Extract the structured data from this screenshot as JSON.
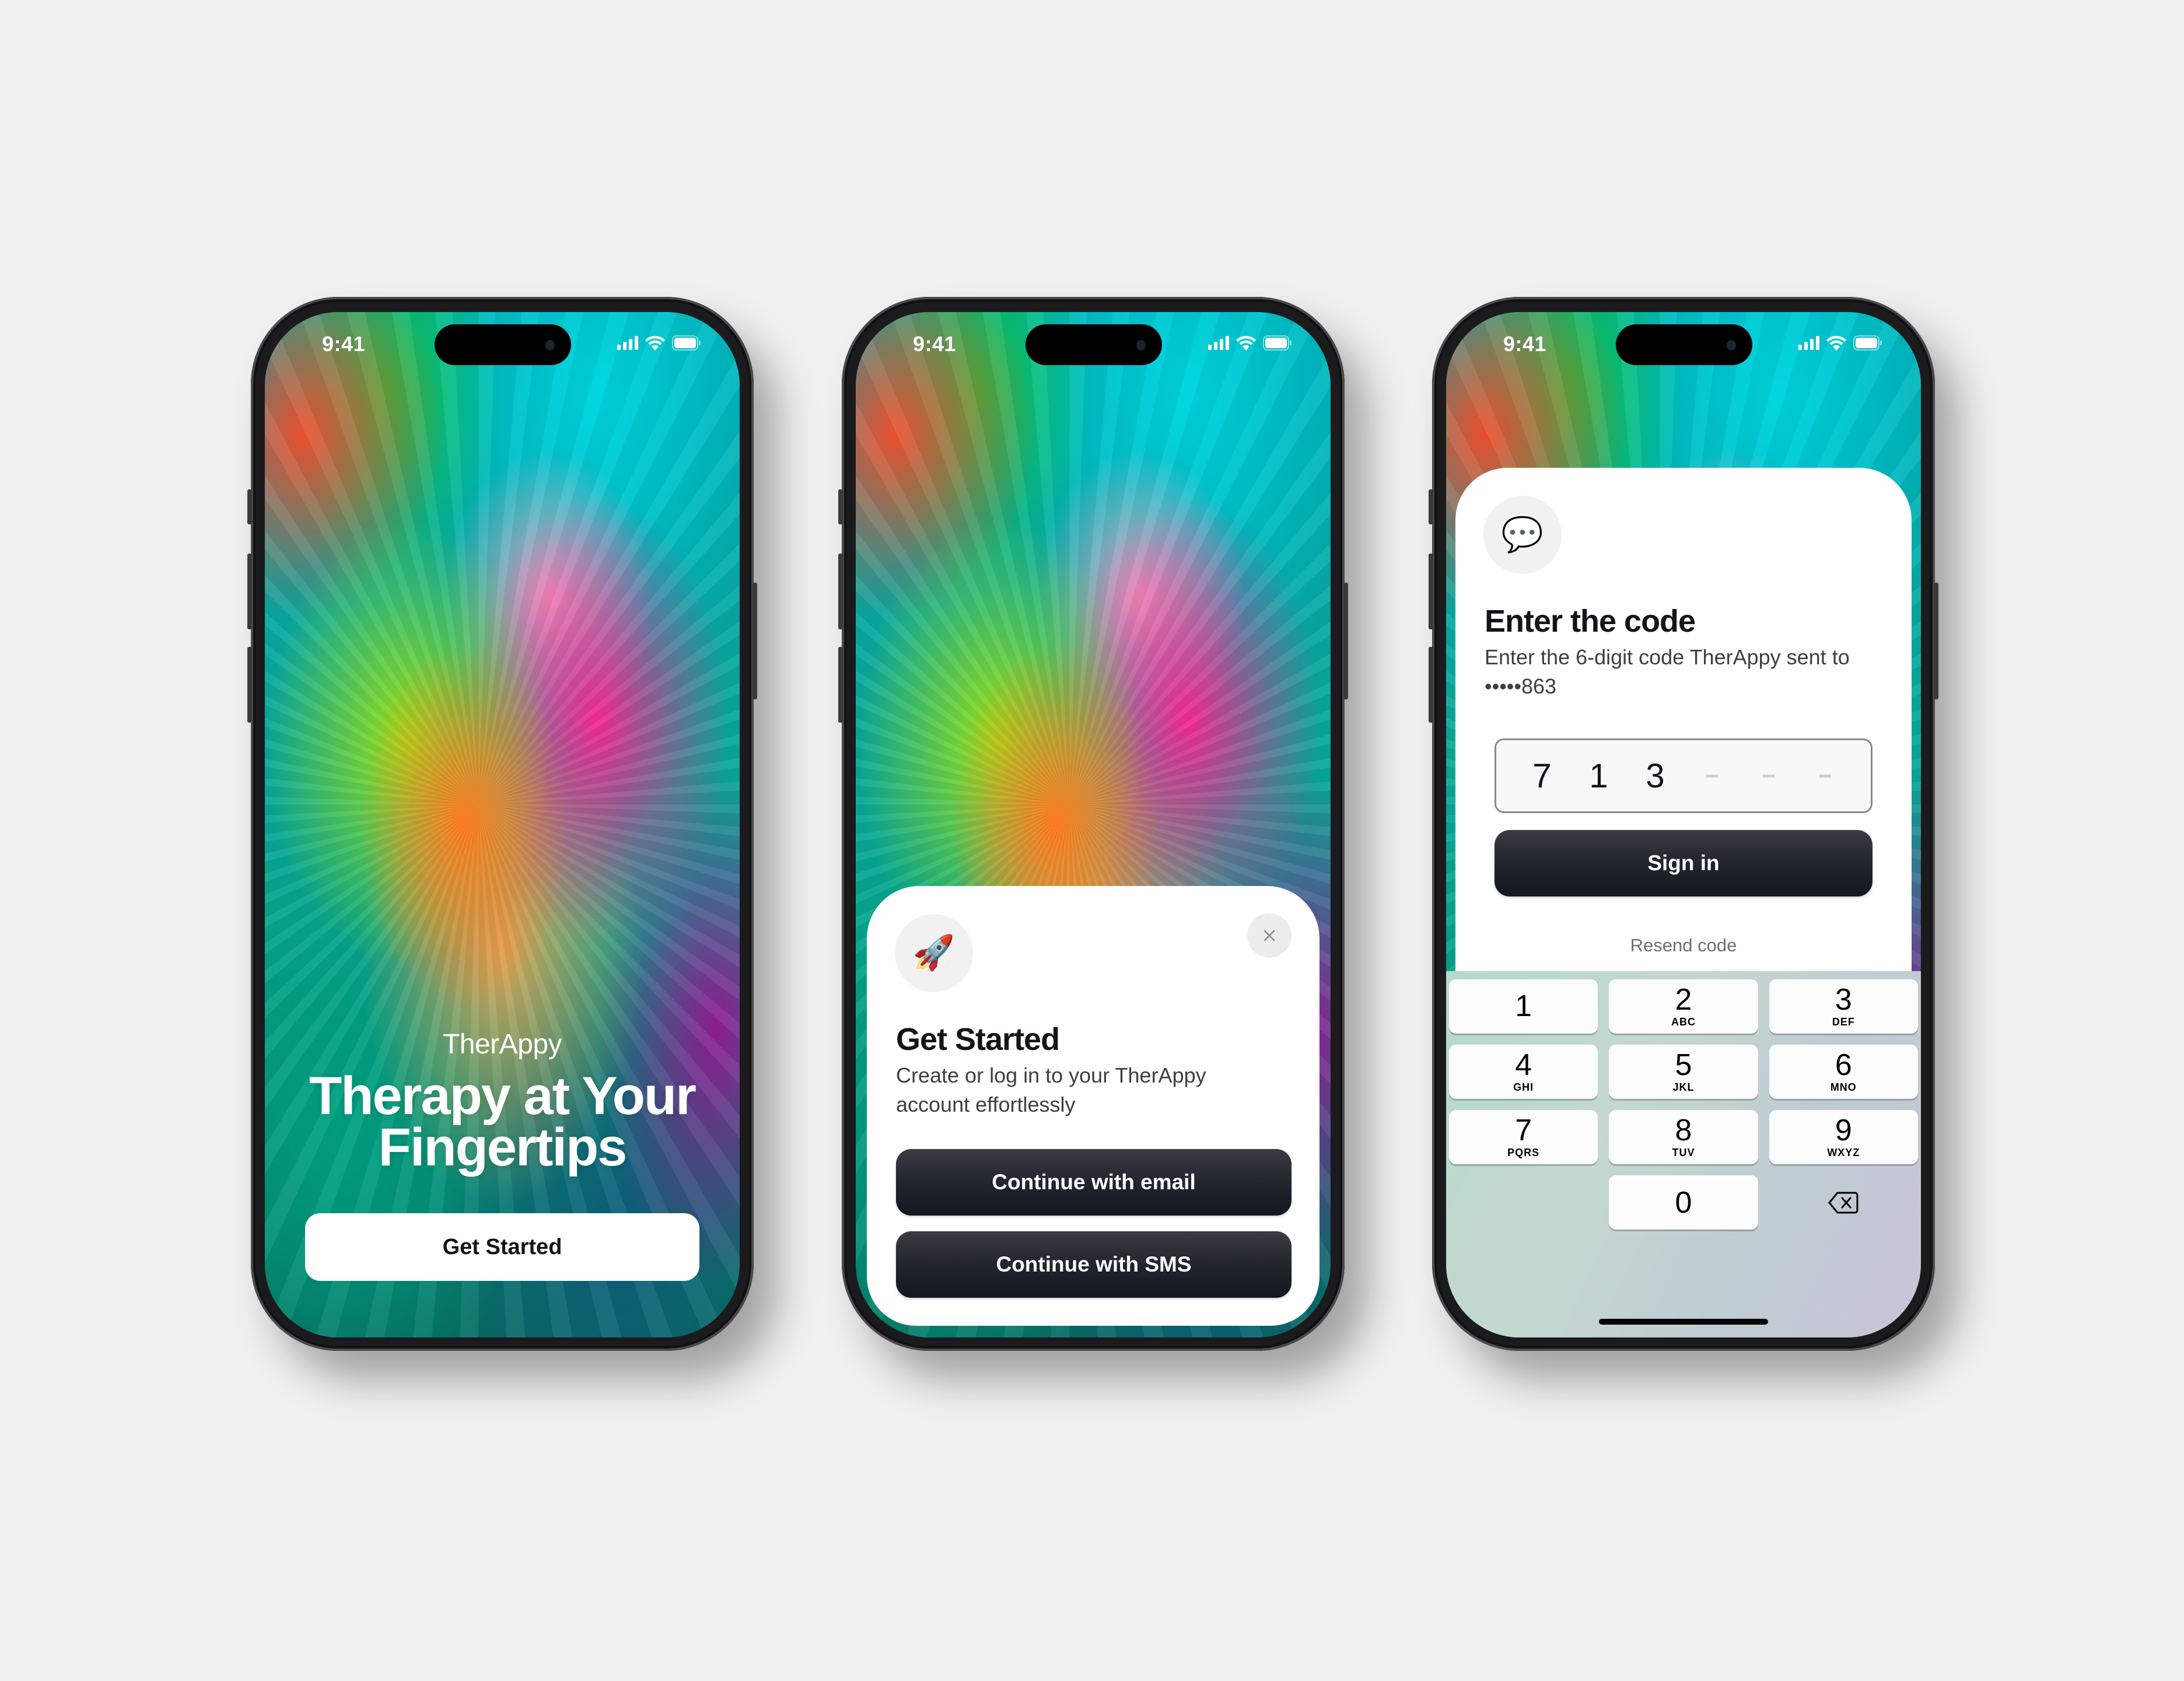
{
  "app_name": "TherApp y",
  "status_bar": {
    "time": "9:41",
    "icons": [
      "cellular-signal-icon",
      "wifi-icon",
      "battery-icon"
    ]
  },
  "screens": {
    "welcome": {
      "brand": "TherAppy",
      "headline": "Therapy at Your Fingertips",
      "cta_label": "Get Started"
    },
    "get_started_sheet": {
      "icon": "🚀",
      "icon_name": "rocket-icon",
      "close_icon": "close-icon",
      "title": "Get Started",
      "subtitle": "Create or log in to your TherAppy account effortlessly",
      "buttons": [
        {
          "label": "Continue with email"
        },
        {
          "label": "Continue with SMS"
        }
      ]
    },
    "verify_code": {
      "icon": "💬",
      "icon_name": "speech-bubble-icon",
      "title": "Enter the code",
      "subtitle": "Enter the 6-digit code TherAppy sent to •••••863",
      "code_digits": [
        "7",
        "1",
        "3",
        "",
        "",
        ""
      ],
      "sign_in_label": "Sign in",
      "resend_label": "Resend code",
      "keypad": [
        {
          "num": "1",
          "letters": ""
        },
        {
          "num": "2",
          "letters": "ABC"
        },
        {
          "num": "3",
          "letters": "DEF"
        },
        {
          "num": "4",
          "letters": "GHI"
        },
        {
          "num": "5",
          "letters": "JKL"
        },
        {
          "num": "6",
          "letters": "MNO"
        },
        {
          "num": "7",
          "letters": "PQRS"
        },
        {
          "num": "8",
          "letters": "TUV"
        },
        {
          "num": "9",
          "letters": "WXYZ"
        },
        {
          "num": "0",
          "letters": ""
        }
      ],
      "delete_icon": "backspace-icon"
    }
  },
  "colors": {
    "background": "#f0f0f0",
    "dark_button": "#1f232a",
    "title_text": "#111418",
    "keypad_bg": "#c5d8cf"
  }
}
